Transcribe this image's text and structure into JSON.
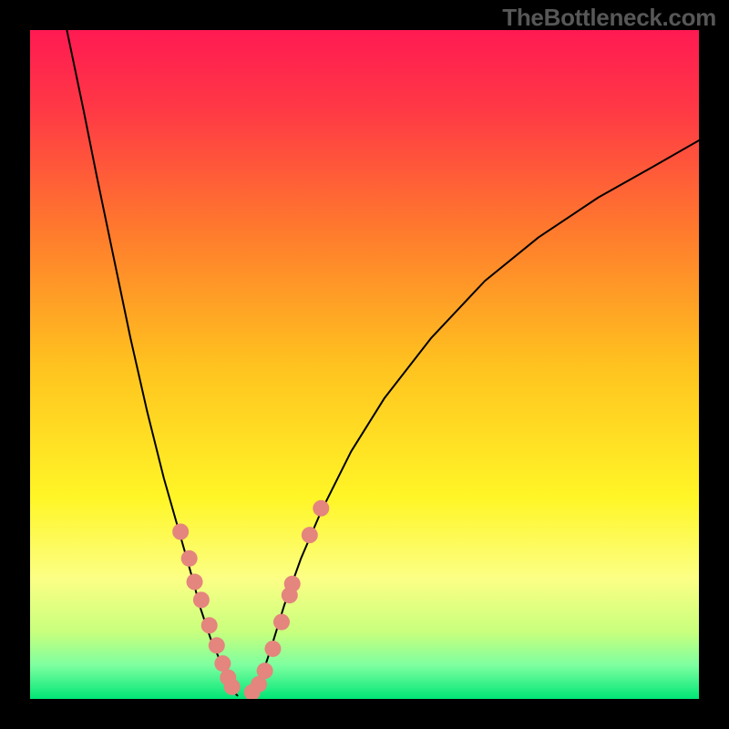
{
  "watermark": "TheBottleneck.com",
  "chart_data": {
    "type": "line",
    "title": "",
    "xlabel": "",
    "ylabel": "",
    "xlim": [
      0,
      100
    ],
    "ylim": [
      0,
      100
    ],
    "background": {
      "type": "vertical_gradient",
      "stops": [
        {
          "pos": 0.0,
          "color": "#ff1a52"
        },
        {
          "pos": 0.12,
          "color": "#ff3945"
        },
        {
          "pos": 0.3,
          "color": "#ff7a2d"
        },
        {
          "pos": 0.5,
          "color": "#ffc21f"
        },
        {
          "pos": 0.7,
          "color": "#fff627"
        },
        {
          "pos": 0.82,
          "color": "#fcff85"
        },
        {
          "pos": 0.9,
          "color": "#c8ff7d"
        },
        {
          "pos": 0.95,
          "color": "#7dffa0"
        },
        {
          "pos": 1.0,
          "color": "#00e676"
        }
      ]
    },
    "series": [
      {
        "name": "left_curve",
        "color": "#000000",
        "width": 2,
        "x": [
          5.5,
          8.0,
          10.0,
          12.5,
          15.0,
          17.5,
          20.0,
          22.0,
          24.0,
          25.5,
          27.0,
          28.5,
          29.5,
          30.0,
          30.5,
          31.0
        ],
        "y": [
          100,
          88,
          78,
          66,
          54,
          43,
          33,
          26,
          19,
          13.5,
          9.0,
          5.5,
          3.0,
          2.0,
          1.0,
          0.5
        ]
      },
      {
        "name": "right_curve",
        "color": "#000000",
        "width": 2,
        "x": [
          33.5,
          34.5,
          36.0,
          38.0,
          40.5,
          43.5,
          48.0,
          53.0,
          60.0,
          68.0,
          76.0,
          85.0,
          93.0,
          100.0
        ],
        "y": [
          0.5,
          3.0,
          7.5,
          14.0,
          21.0,
          28.0,
          37.0,
          45.0,
          54.0,
          62.5,
          69.0,
          75.0,
          79.5,
          83.5
        ]
      }
    ],
    "scatter": {
      "name": "marker_dots",
      "color": "#e4857e",
      "radius": 9,
      "points": [
        {
          "x": 22.5,
          "y": 25.0
        },
        {
          "x": 23.8,
          "y": 21.0
        },
        {
          "x": 24.6,
          "y": 17.5
        },
        {
          "x": 25.6,
          "y": 14.8
        },
        {
          "x": 26.8,
          "y": 11.0
        },
        {
          "x": 27.9,
          "y": 8.0
        },
        {
          "x": 28.8,
          "y": 5.3
        },
        {
          "x": 29.6,
          "y": 3.2
        },
        {
          "x": 30.2,
          "y": 1.8
        },
        {
          "x": 33.2,
          "y": 1.0
        },
        {
          "x": 34.2,
          "y": 2.2
        },
        {
          "x": 35.1,
          "y": 4.2
        },
        {
          "x": 36.3,
          "y": 7.5
        },
        {
          "x": 37.6,
          "y": 11.5
        },
        {
          "x": 38.8,
          "y": 15.5
        },
        {
          "x": 39.2,
          "y": 17.2
        },
        {
          "x": 41.8,
          "y": 24.5
        },
        {
          "x": 43.5,
          "y": 28.5
        }
      ]
    }
  }
}
